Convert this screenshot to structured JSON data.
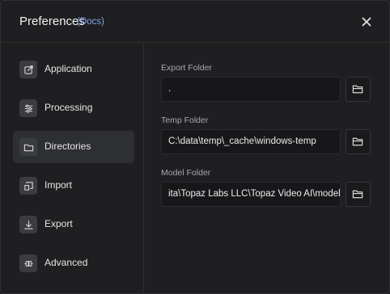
{
  "header": {
    "title": "Preferences",
    "docs_link": "(Docs)"
  },
  "sidebar": {
    "items": [
      {
        "label": "Application",
        "icon": "application-icon"
      },
      {
        "label": "Processing",
        "icon": "sliders-icon"
      },
      {
        "label": "Directories",
        "icon": "folder-icon",
        "active": true
      },
      {
        "label": "Import",
        "icon": "import-icon"
      },
      {
        "label": "Export",
        "icon": "download-icon"
      },
      {
        "label": "Advanced",
        "icon": "advanced-icon"
      }
    ]
  },
  "directories": {
    "export_folder": {
      "label": "Export Folder",
      "value": "."
    },
    "temp_folder": {
      "label": "Temp Folder",
      "value": "C:\\data\\temp\\_cache\\windows-temp"
    },
    "model_folder": {
      "label": "Model Folder",
      "value": "ita\\Topaz Labs LLC\\Topaz Video AI\\models"
    }
  },
  "colors": {
    "background": "#1f1f21",
    "accent_link": "#7fa6e8",
    "active_item": "#2e2f33"
  }
}
